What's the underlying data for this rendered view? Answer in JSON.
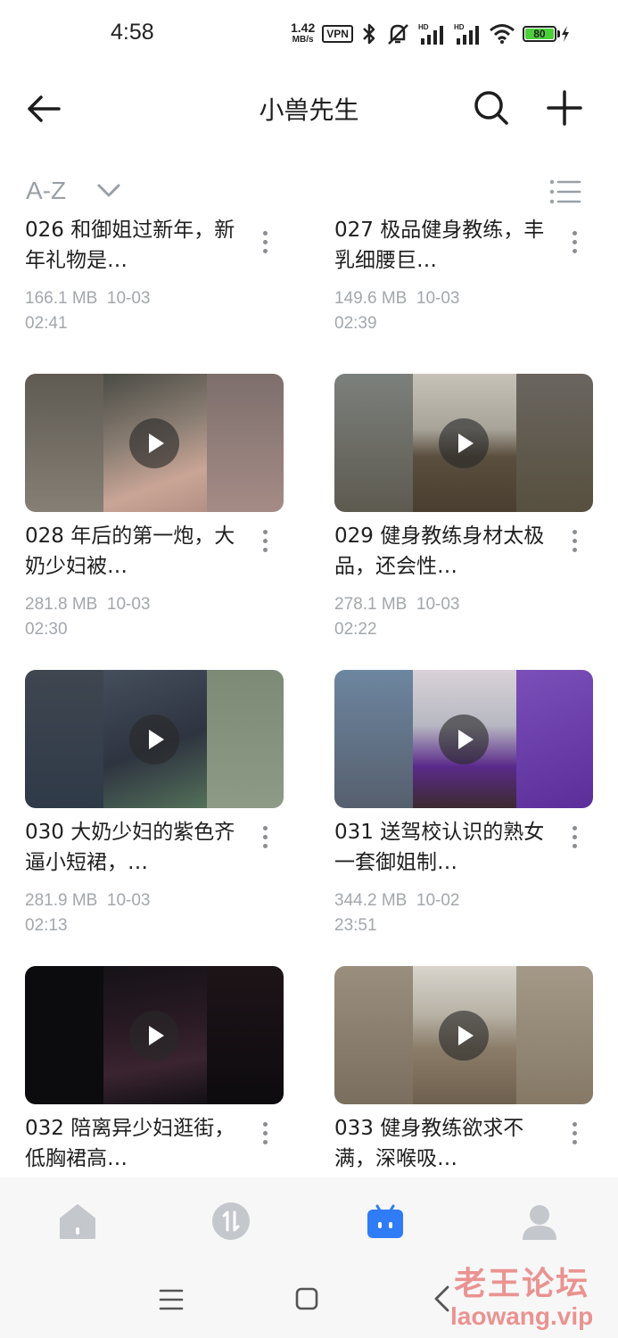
{
  "status_bar": {
    "time": "4:58",
    "net_speed": "1.42",
    "net_unit": "MB/s",
    "vpn": "VPN",
    "battery": "80",
    "signal_label": "HD"
  },
  "header": {
    "title": "小兽先生",
    "back_icon": "arrow-left-icon",
    "search_icon": "search-icon",
    "add_icon": "plus-icon"
  },
  "sort": {
    "label": "A-Z",
    "view_icon": "list-view-icon"
  },
  "files": [
    {
      "name": "026 和御姐过新年，新年礼物是…",
      "size": "166.1 MB",
      "date": "10-03",
      "time": "02:41"
    },
    {
      "name": "027 极品健身教练，丰乳细腰巨…",
      "size": "149.6 MB",
      "date": "10-03",
      "time": "02:39"
    },
    {
      "name": "028 年后的第一炮，大奶少妇被…",
      "size": "281.8 MB",
      "date": "10-03",
      "time": "02:30"
    },
    {
      "name": "029 健身教练身材太极品，还会性…",
      "size": "278.1 MB",
      "date": "10-03",
      "time": "02:22"
    },
    {
      "name": "030 大奶少妇的紫色齐逼小短裙，…",
      "size": "281.9 MB",
      "date": "10-03",
      "time": "02:13"
    },
    {
      "name": "031 送驾校认识的熟女一套御姐制…",
      "size": "344.2 MB",
      "date": "10-02",
      "time": "23:51"
    },
    {
      "name": "032 陪离异少妇逛街，低胸裙高…",
      "size": "",
      "date": "",
      "time": ""
    },
    {
      "name": "033 健身教练欲求不满，深喉吸…",
      "size": "",
      "date": "",
      "time": ""
    }
  ],
  "bottom_nav": [
    "home-icon",
    "transfer-icon",
    "files-icon",
    "profile-icon"
  ],
  "watermark": {
    "cn": "老王论坛",
    "en": "laowang.vip"
  },
  "colors": {
    "accent": "#2f7cf6",
    "muted": "#a3a7ac",
    "nav_gray": "#c4c7cc"
  }
}
